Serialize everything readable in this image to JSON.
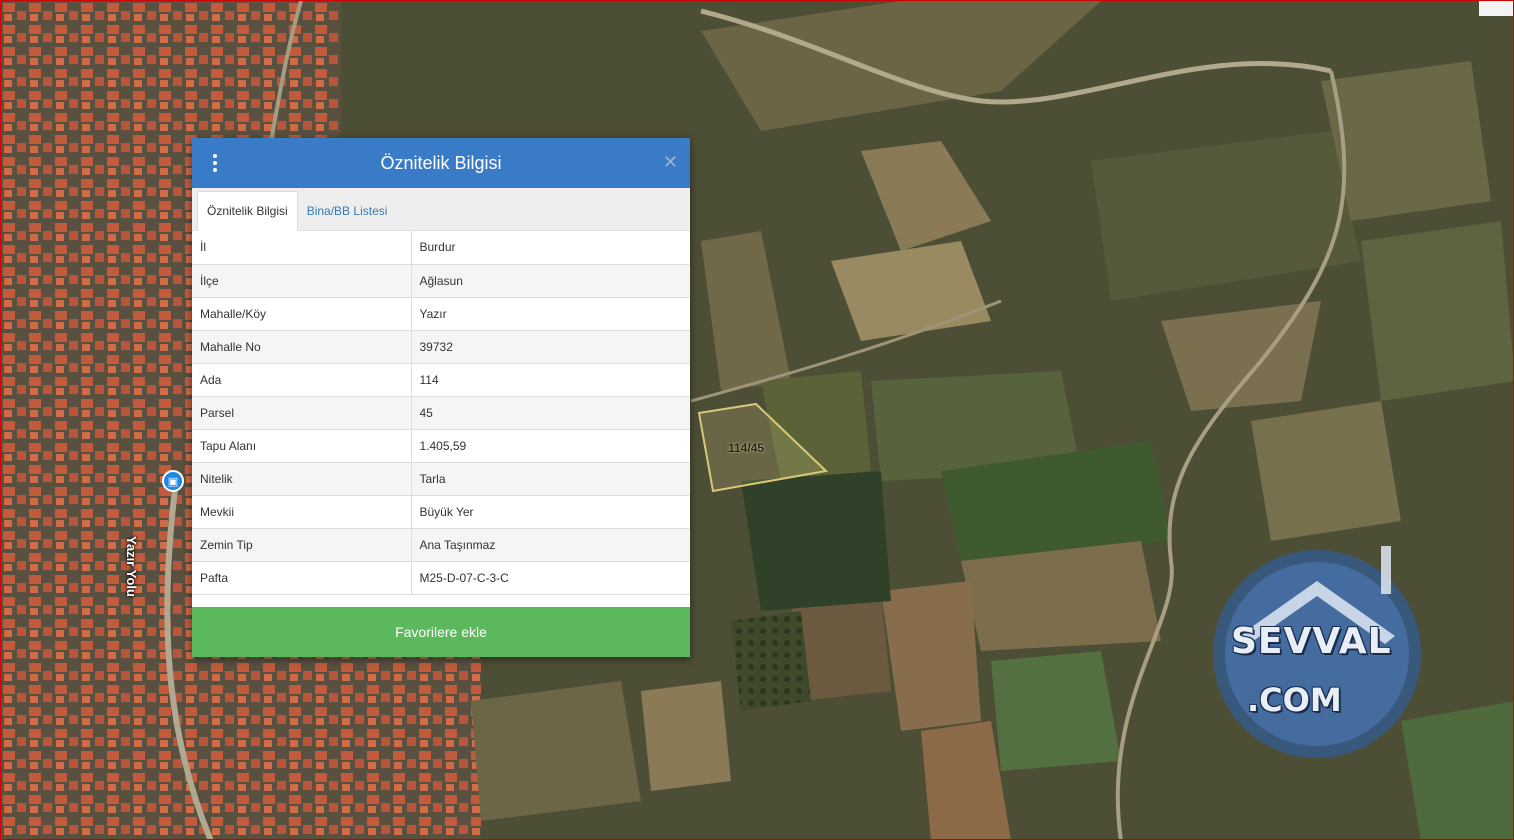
{
  "map": {
    "road_label": "Yazır Yolu",
    "parcel_label": "114/45",
    "bus_icon": "bus-stop-icon"
  },
  "watermark": {
    "line1": "SEVVAL",
    "line2": ".COM"
  },
  "dialog": {
    "title": "Öznitelik Bilgisi",
    "menu_icon": "kebab-menu-icon",
    "close_icon": "close-icon",
    "close_glyph": "✕",
    "tabs": [
      {
        "label": "Öznitelik Bilgisi",
        "active": true
      },
      {
        "label": "Bina/BB Listesi",
        "active": false
      }
    ],
    "rows": [
      {
        "key": "İl",
        "value": "Burdur"
      },
      {
        "key": "İlçe",
        "value": "Ağlasun"
      },
      {
        "key": "Mahalle/Köy",
        "value": "Yazır"
      },
      {
        "key": "Mahalle No",
        "value": "39732"
      },
      {
        "key": "Ada",
        "value": "114"
      },
      {
        "key": "Parsel",
        "value": "45"
      },
      {
        "key": "Tapu Alanı",
        "value": "1.405,59"
      },
      {
        "key": "Nitelik",
        "value": "Tarla"
      },
      {
        "key": "Mevkii",
        "value": "Büyük Yer"
      },
      {
        "key": "Zemin Tip",
        "value": "Ana Taşınmaz"
      },
      {
        "key": "Pafta",
        "value": "M25-D-07-C-3-C"
      }
    ],
    "favorite_button": "Favorilere ekle"
  },
  "colors": {
    "header": "#3a7bc8",
    "button": "#5cb85c",
    "tab_link": "#337ab7"
  }
}
